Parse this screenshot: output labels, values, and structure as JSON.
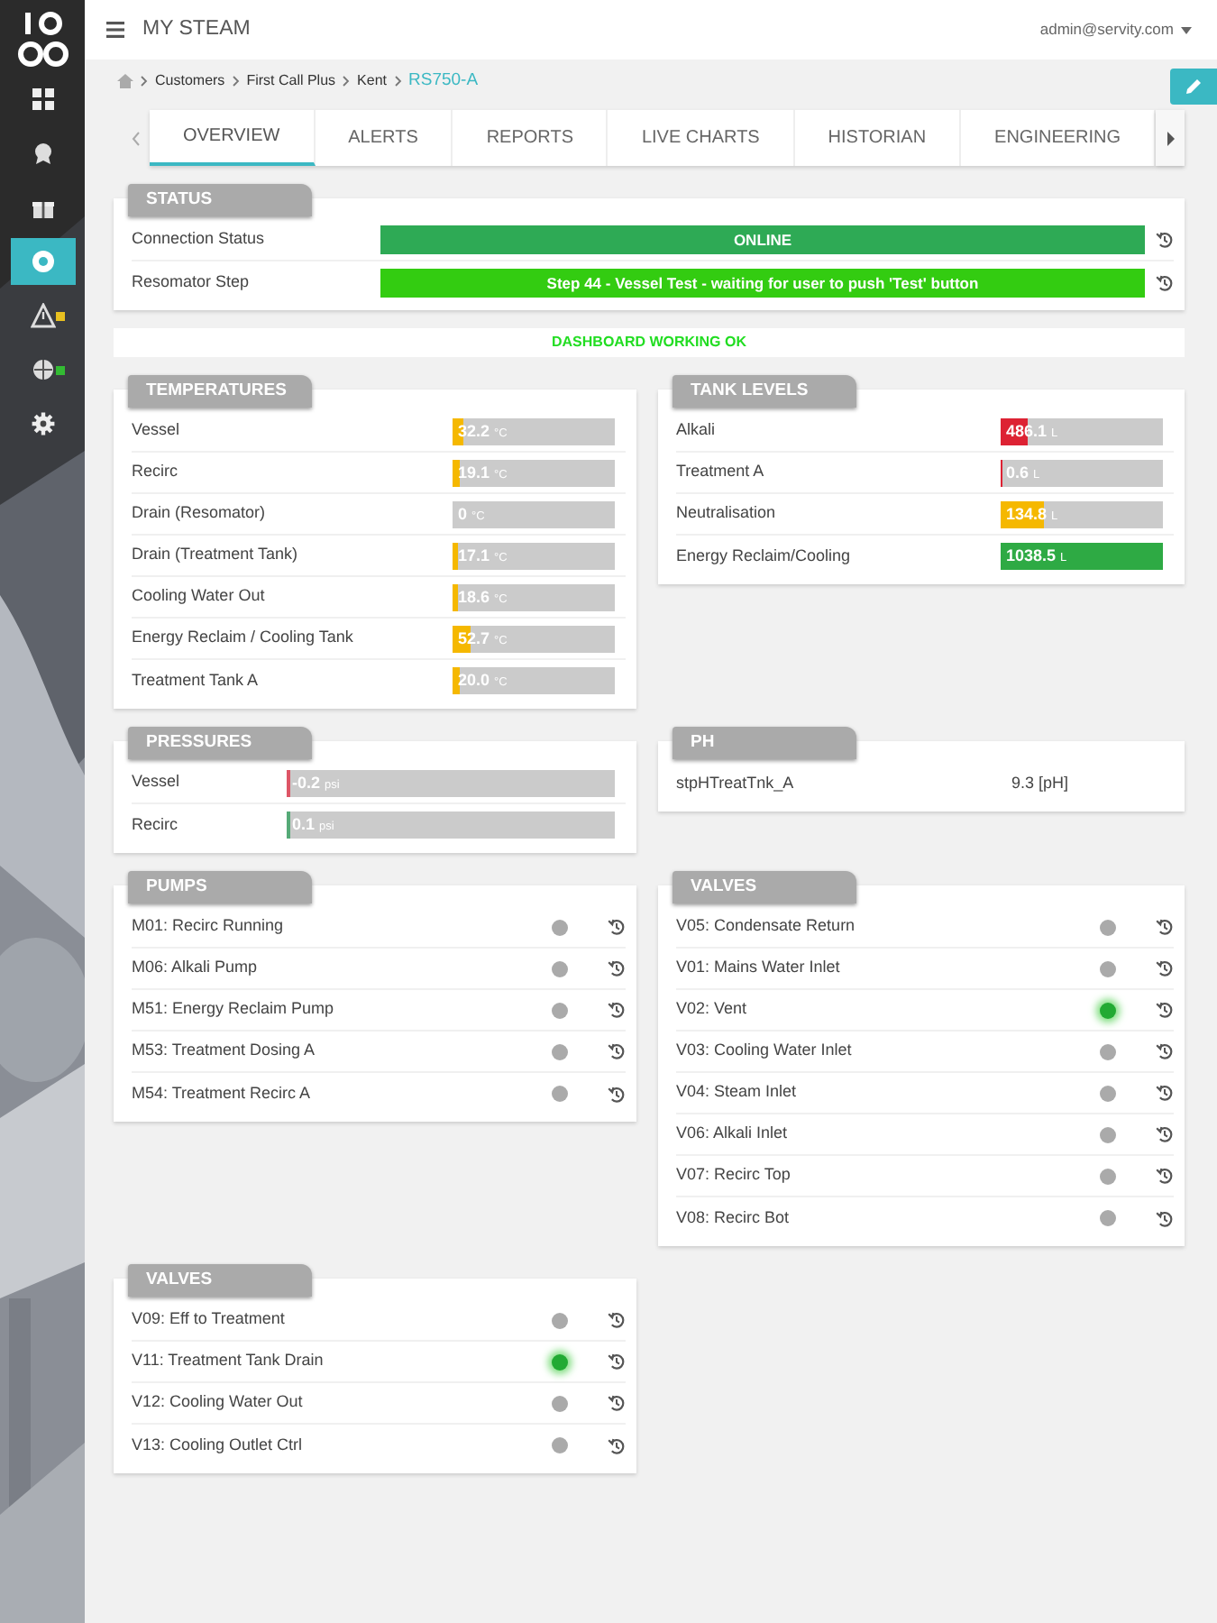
{
  "sidebar": {
    "items": [
      {
        "selected": false
      },
      {
        "selected": false
      },
      {
        "selected": false
      },
      {
        "selected": true
      },
      {
        "selected": false,
        "color": "#e8c020"
      },
      {
        "selected": false,
        "color": "#33bb33"
      },
      {
        "selected": false
      }
    ]
  },
  "header": {
    "title": "MY STEAM",
    "user": "admin@servity.com"
  },
  "breadcrumb": [
    {
      "label": "Customers",
      "current": false
    },
    {
      "label": "First Call Plus",
      "current": false
    },
    {
      "label": "Kent",
      "current": false
    },
    {
      "label": "RS750-A",
      "current": true
    }
  ],
  "tabs": [
    {
      "label": "OVERVIEW",
      "selected": true
    },
    {
      "label": "ALERTS",
      "selected": false
    },
    {
      "label": "REPORTS",
      "selected": false
    },
    {
      "label": "LIVE CHARTS",
      "selected": false
    },
    {
      "label": "HISTORIAN",
      "selected": false
    },
    {
      "label": "ENGINEERING",
      "selected": false
    }
  ],
  "status": {
    "title": "STATUS",
    "rows": [
      {
        "label": "Connection Status",
        "value": "ONLINE",
        "color": "#2eaa55"
      },
      {
        "label": "Resomator Step",
        "value": "Step 44 - Vessel Test - waiting for user to push 'Test' button",
        "color": "#33cc11"
      }
    ]
  },
  "dashboard_message": "DASHBOARD WORKING OK",
  "panels": [
    {
      "kind": "gauges",
      "title": "TEMPERATURES",
      "rows": [
        {
          "label": "Vessel",
          "value": "32.2",
          "unit": "°C",
          "level": 0.07,
          "color": "#f5b800"
        },
        {
          "label": "Recirc",
          "value": "19.1",
          "unit": "°C",
          "level": 0.04,
          "color": "#f5b800"
        },
        {
          "label": "Drain (Resomator)",
          "value": "0",
          "unit": "°C"
        },
        {
          "label": "Drain (Treatment Tank)",
          "value": "17.1",
          "unit": "°C",
          "level": 0.03,
          "color": "#f5b800"
        },
        {
          "label": "Cooling Water Out",
          "value": "18.6",
          "unit": "°C",
          "level": 0.03,
          "color": "#f5b800"
        },
        {
          "label": "Energy Reclaim / Cooling Tank",
          "value": "52.7",
          "unit": "°C",
          "level": 0.11,
          "color": "#f5b800"
        },
        {
          "label": "Treatment Tank A",
          "value": "20.0",
          "unit": "°C",
          "level": 0.04,
          "color": "#f5b800"
        }
      ]
    },
    {
      "kind": "gauges",
      "title": "TANK LEVELS",
      "rows": [
        {
          "label": "Alkali",
          "value": "486.1",
          "unit": "L",
          "level": 0.17,
          "color": "#dd2233"
        },
        {
          "label": "Treatment A",
          "value": "0.6",
          "unit": "L",
          "level": 0.01,
          "color": "#dd2233"
        },
        {
          "label": "Neutralisation",
          "value": "134.8",
          "unit": "L",
          "level": 0.27,
          "color": "#f5b800"
        },
        {
          "label": "Energy Reclaim/Cooling",
          "value": "1038.5",
          "unit": "L",
          "level": 1,
          "color": "#2eaa44"
        }
      ]
    },
    {
      "kind": "gauges",
      "title": "PRESSURES",
      "rows": [
        {
          "label": "Vessel",
          "value": "-0.2",
          "unit": "psi",
          "level": 0.01,
          "color": "#dd5566"
        },
        {
          "label": "Recirc",
          "value": "0.1",
          "unit": "psi",
          "level": 0.01,
          "color": "#55aa77"
        }
      ]
    },
    {
      "kind": "readings",
      "title": "PH",
      "rows": [
        {
          "label": "stpHTreatTnk_A",
          "value": "9.3 [pH]"
        }
      ]
    },
    {
      "kind": "indicators",
      "title": "PUMPS",
      "rows": [
        {
          "label": "M01: Recirc Running",
          "on": false
        },
        {
          "label": "M06: Alkali Pump",
          "on": false
        },
        {
          "label": "M51: Energy Reclaim Pump",
          "on": false
        },
        {
          "label": "M53: Treatment Dosing A",
          "on": false
        },
        {
          "label": "M54: Treatment Recirc A",
          "on": false
        }
      ]
    },
    {
      "kind": "indicators",
      "title": "VALVES",
      "rows": [
        {
          "label": "V05: Condensate Return",
          "on": false
        },
        {
          "label": "V01: Mains Water Inlet",
          "on": false
        },
        {
          "label": "V02: Vent",
          "on": true
        },
        {
          "label": "V03: Cooling Water Inlet",
          "on": false
        },
        {
          "label": "V04: Steam Inlet",
          "on": false
        },
        {
          "label": "V06: Alkali Inlet",
          "on": false
        },
        {
          "label": "V07: Recirc Top",
          "on": false
        },
        {
          "label": "V08: Recirc Bot",
          "on": false
        }
      ]
    },
    {
      "kind": "indicators",
      "title": "VALVES",
      "rows": [
        {
          "label": "V09: Eff to Treatment",
          "on": false
        },
        {
          "label": "V11: Treatment Tank Drain",
          "on": true
        },
        {
          "label": "V12: Cooling Water Out",
          "on": false
        },
        {
          "label": "V13: Cooling Outlet Ctrl",
          "on": false
        }
      ]
    }
  ]
}
